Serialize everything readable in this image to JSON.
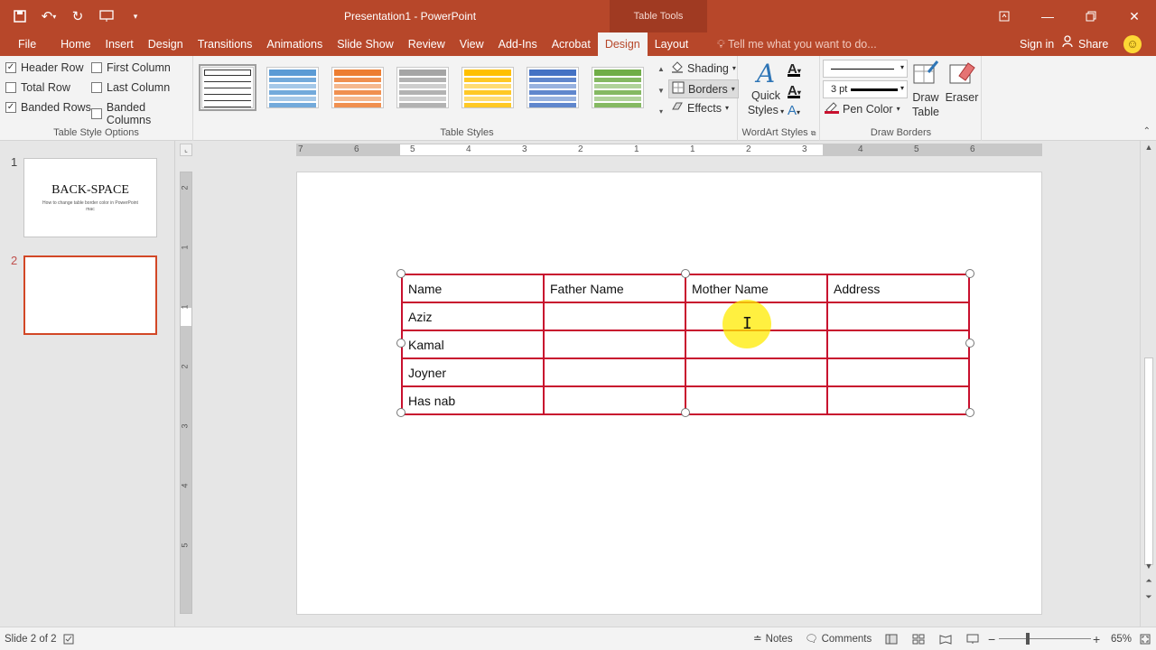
{
  "app": {
    "title": "Presentation1 - PowerPoint",
    "context_tab_group": "Table Tools"
  },
  "qat": {
    "save_icon": "save-icon",
    "undo_icon": "undo-icon",
    "redo_icon": "repeat-icon",
    "present_icon": "present-icon",
    "more_icon": "customize-icon"
  },
  "tabs": [
    {
      "label": "File"
    },
    {
      "label": "Home"
    },
    {
      "label": "Insert"
    },
    {
      "label": "Design"
    },
    {
      "label": "Transitions"
    },
    {
      "label": "Animations"
    },
    {
      "label": "Slide Show"
    },
    {
      "label": "Review"
    },
    {
      "label": "View"
    },
    {
      "label": "Add-Ins"
    },
    {
      "label": "Acrobat"
    },
    {
      "label": "Design"
    },
    {
      "label": "Layout"
    }
  ],
  "tellme": "Tell me what you want to do...",
  "signin": "Sign in",
  "share": "Share",
  "ribbon": {
    "table_style_options": {
      "label": "Table Style Options",
      "header_row": "Header Row",
      "total_row": "Total Row",
      "banded_rows": "Banded Rows",
      "first_column": "First Column",
      "last_column": "Last Column",
      "banded_columns": "Banded Columns"
    },
    "table_styles": {
      "label": "Table Styles"
    },
    "shading": "Shading",
    "borders": "Borders",
    "effects": "Effects",
    "wordart": {
      "label": "WordArt Styles",
      "quick_styles_1": "Quick",
      "quick_styles_2": "Styles"
    },
    "draw_borders": {
      "label": "Draw Borders",
      "pen_weight": "3 pt",
      "pen_color": "Pen Color",
      "draw_table_1": "Draw",
      "draw_table_2": "Table",
      "eraser": "Eraser"
    }
  },
  "style_colors": [
    "#ffffff",
    "#5b9bd5",
    "#ed7d31",
    "#a5a5a5",
    "#ffc000",
    "#4472c4",
    "#70ad47"
  ],
  "slides": [
    {
      "num": "1",
      "title": "BACK-SPACE",
      "subtitle": "How to change table border color in PowerPoint mac"
    },
    {
      "num": "2"
    }
  ],
  "hruler_labels": [
    "7",
    "6",
    "5",
    "4",
    "3",
    "2",
    "1",
    "1",
    "2",
    "3",
    "4",
    "5",
    "6"
  ],
  "vruler_labels": [
    "2",
    "1",
    "1",
    "2",
    "3",
    "4",
    "5"
  ],
  "table": {
    "rows": [
      [
        "Name",
        "Father Name",
        "Mother Name",
        "Address"
      ],
      [
        "Aziz",
        "",
        "",
        ""
      ],
      [
        "Kamal",
        "",
        "",
        ""
      ],
      [
        "Joyner",
        "",
        "",
        ""
      ],
      [
        "Has nab",
        "",
        "",
        ""
      ]
    ],
    "border_color": "#c8102e"
  },
  "status": {
    "slide": "Slide 2 of 2",
    "notes": "Notes",
    "comments": "Comments",
    "zoom": "65%"
  },
  "colors": {
    "accent": "#b7472a",
    "context_tab": "#a03a22"
  }
}
